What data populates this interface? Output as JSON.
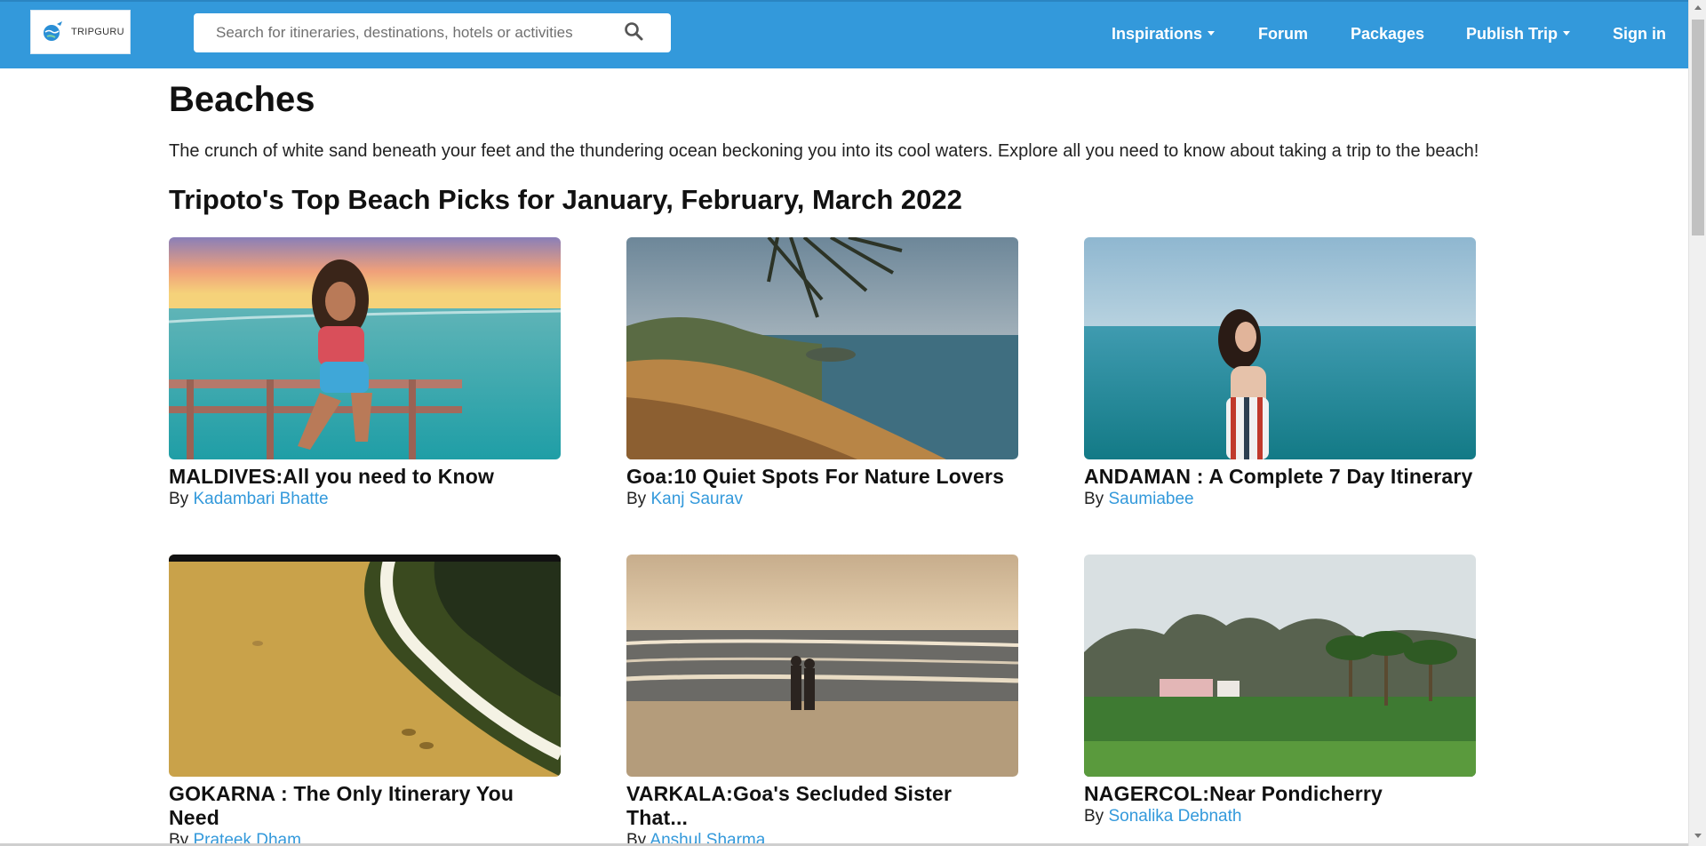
{
  "header": {
    "logo_text": "TRIPGURU",
    "search": {
      "placeholder": "Search for itineraries, destinations, hotels or activities",
      "value": ""
    },
    "nav": {
      "inspirations": "Inspirations",
      "forum": "Forum",
      "packages": "Packages",
      "publish_trip": "Publish Trip",
      "sign_in": "Sign in"
    }
  },
  "main": {
    "title": "Beaches",
    "intro": "The crunch of white sand beneath your feet and the thundering ocean beckoning you into its cool waters. Explore all you need to know about taking a trip to the beach!",
    "section_title": "Tripoto's Top Beach Picks for January, February, March 2022",
    "by_label": "By",
    "cards": [
      {
        "title": "MALDIVES:All you need to Know",
        "author": "Kadambari Bhatte",
        "image": "maldives-woman-on-deck-sunset"
      },
      {
        "title": "Goa:10 Quiet Spots For Nature Lovers",
        "author": "Kanj Saurav",
        "image": "goa-cliff-sea-palm"
      },
      {
        "title": "ANDAMAN : A Complete 7 Day Itinerary",
        "author": "Saumiabee",
        "image": "andaman-woman-sea"
      },
      {
        "title": "GOKARNA : The Only Itinerary You Need",
        "author": "Prateek Dham",
        "image": "gokarna-footprints-shore"
      },
      {
        "title": "VARKALA:Goa's Secluded Sister That...",
        "author": "Anshul Sharma",
        "image": "varkala-couple-sunset-beach"
      },
      {
        "title": "NAGERCOL:Near Pondicherry",
        "author": "Sonalika Debnath",
        "image": "nagercol-mountains-palms"
      }
    ]
  },
  "colors": {
    "header_bg": "#3399db",
    "link": "#3399db",
    "text": "#111111"
  }
}
